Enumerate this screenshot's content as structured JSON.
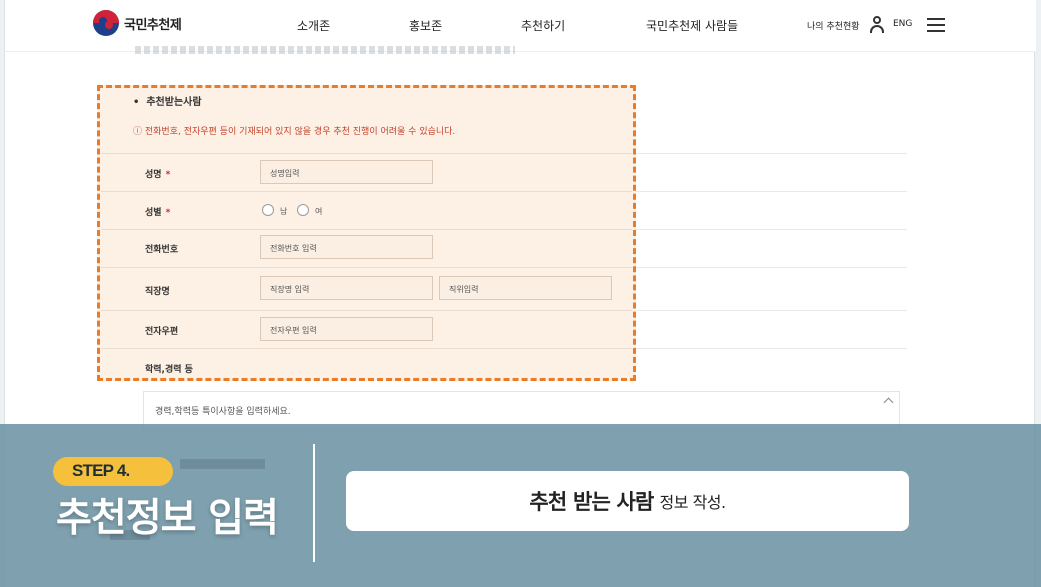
{
  "header": {
    "brand": "국민추천제",
    "nav": [
      "소개존",
      "홍보존",
      "추천하기",
      "국민추천제 사람들"
    ],
    "my_status": "나의 추천현황",
    "lang": "ENG"
  },
  "form": {
    "section_title": "추천받는사람",
    "notice": "ⓘ 전화번호, 전자우편 등이 기재되어 있지 않을 경우 추천 진행이 어려울 수 있습니다.",
    "required_mark": "*",
    "name": {
      "label": "성명",
      "placeholder": "성명입력"
    },
    "gender": {
      "label": "성별",
      "options": [
        "남",
        "여"
      ]
    },
    "phone": {
      "label": "전화번호",
      "placeholder": "전화번호 입력"
    },
    "workplace": {
      "label": "직장명",
      "placeholder": "직장명 입력",
      "position_placeholder": "직위입력"
    },
    "email": {
      "label": "전자우편",
      "placeholder": "전자우편 입력"
    },
    "career": {
      "label": "학력,경력 등",
      "placeholder": "경력,학력등 특이사항을 입력하세요."
    }
  },
  "banner": {
    "step": "STEP 4.",
    "title": "추천정보 입력",
    "caption_strong": "추천 받는 사람",
    "caption_rest": "정보 작성."
  },
  "colors": {
    "highlight_border": "#e87c2a",
    "banner_bg": "#6a92a2",
    "step_pill": "#f5c03c",
    "required": "#d0233a"
  },
  "icons": [
    "taegeuk-logo-icon",
    "user-icon",
    "hamburger-menu-icon",
    "chevron-up-icon"
  ]
}
